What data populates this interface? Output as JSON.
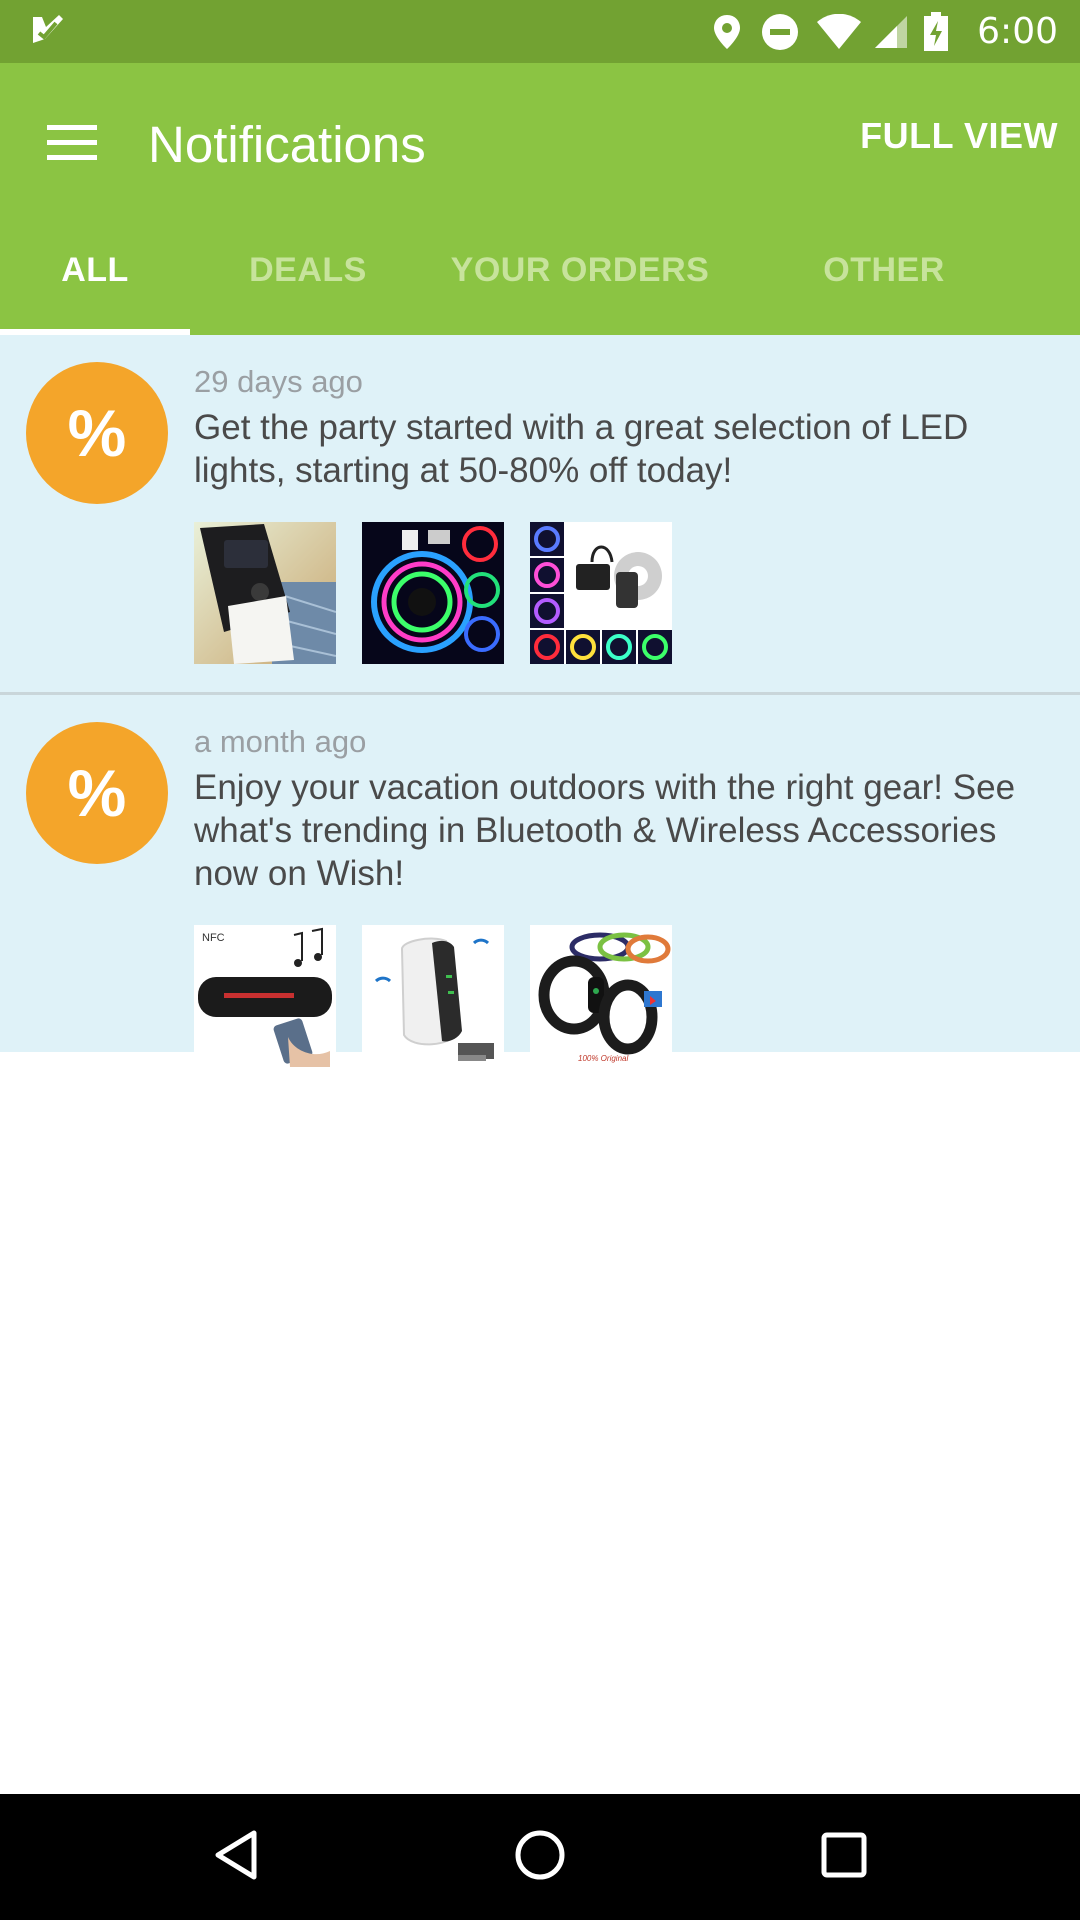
{
  "status_bar": {
    "time": "6:00",
    "icons": [
      "check-notification-icon",
      "location-icon",
      "do-not-disturb-icon",
      "wifi-icon",
      "cell-signal-icon",
      "battery-charging-icon"
    ]
  },
  "app_bar": {
    "title": "Notifications",
    "action_label": "FULL VIEW",
    "menu_icon": "hamburger-menu-icon"
  },
  "tabs": [
    {
      "label": "ALL",
      "active": true
    },
    {
      "label": "DEALS",
      "active": false
    },
    {
      "label": "YOUR ORDERS",
      "active": false
    },
    {
      "label": "OTHER",
      "active": false
    }
  ],
  "notifications": [
    {
      "icon": "%",
      "time": "29 days ago",
      "text": "Get the party started with a great selection of LED lights, starting at 50-80% off today!",
      "thumbnails": [
        "solar-wall-light-image",
        "rgb-led-strip-reel-image",
        "led-strip-kit-image"
      ]
    },
    {
      "icon": "%",
      "time": "a month ago",
      "text": "Enjoy your vacation outdoors with the right gear! See what's trending in Bluetooth & Wireless Accessories now on Wish!",
      "thumbnails": [
        "bluetooth-speaker-image",
        "wifi-extender-image",
        "fitness-bands-image"
      ],
      "thumbnail_text": {
        "nfc": "NFC",
        "original": "100% Original"
      }
    }
  ],
  "nav_bar": {
    "icons": [
      "back-icon",
      "home-icon",
      "recent-apps-icon"
    ]
  },
  "colors": {
    "status_bar": "#72a232",
    "app_bar": "#8bc443",
    "list_bg": "#dff2f8",
    "badge": "#f4a52a",
    "inactive_tab": "#c7e39c"
  }
}
